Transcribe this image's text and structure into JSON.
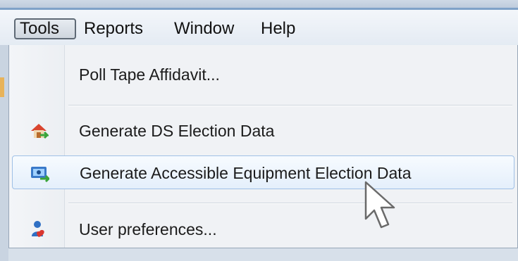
{
  "menubar": {
    "items": [
      {
        "label": "Tools"
      },
      {
        "label": "Reports"
      },
      {
        "label": "Window"
      },
      {
        "label": "Help"
      }
    ]
  },
  "dropdown": {
    "items": [
      {
        "label": "Poll Tape Affidavit...",
        "icon": null
      },
      {
        "label": "Generate DS Election Data",
        "icon": "house-arrow-icon"
      },
      {
        "label": "Generate Accessible Equipment Election Data",
        "icon": "accessible-equipment-icon",
        "highlighted": true
      },
      {
        "label": "User preferences...",
        "icon": "user-icon"
      }
    ]
  },
  "colors": {
    "highlight_border": "#9fc0e6",
    "highlight_bg": "#e4effb",
    "menu_text": "#111111"
  }
}
